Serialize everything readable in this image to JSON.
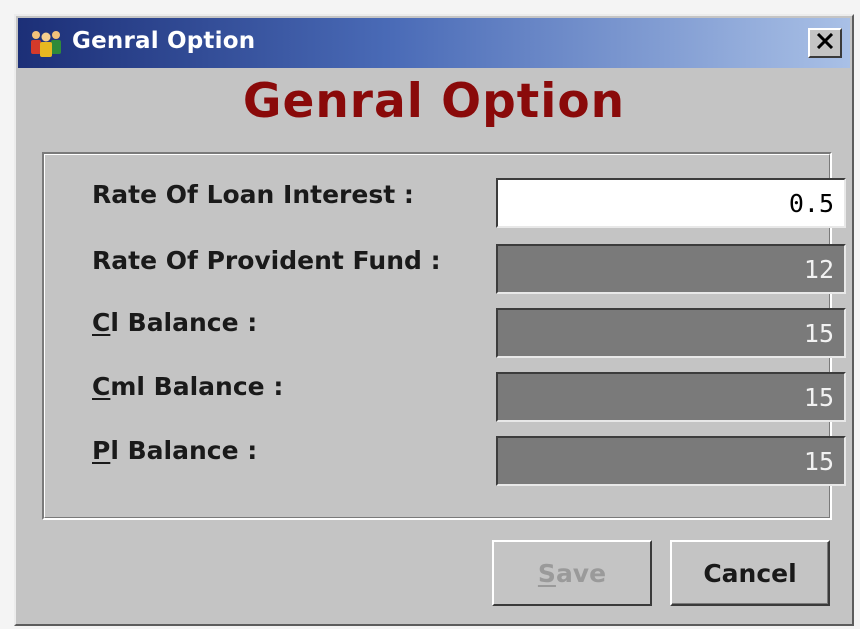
{
  "window": {
    "title": "Genral Option",
    "close_glyph": "✕",
    "icon": "people-group-icon"
  },
  "heading": "Genral Option",
  "fields": [
    {
      "label": "Rate Of Loan Interest :",
      "value": "0.5",
      "state": "active"
    },
    {
      "label": "Rate Of Provident Fund :",
      "value": "12",
      "state": "disabled"
    },
    {
      "label_underline": "C",
      "label_rest": "l Balance :",
      "value": "15",
      "state": "disabled"
    },
    {
      "label_underline": "C",
      "label_rest": "ml Balance :",
      "value": "15",
      "state": "disabled"
    },
    {
      "label_underline": "P",
      "label_rest": "l Balance :",
      "value": "15",
      "state": "disabled"
    }
  ],
  "buttons": {
    "save_underline": "S",
    "save_rest": "ave",
    "save_state": "disabled",
    "cancel": "Cancel"
  },
  "colors": {
    "title_bar_start": "#1c2f77",
    "title_bar_end": "#a9c0e6",
    "heading": "#8a0a0a",
    "dialog_bg": "#c4c4c4",
    "disabled_field": "#7a7a7a"
  }
}
